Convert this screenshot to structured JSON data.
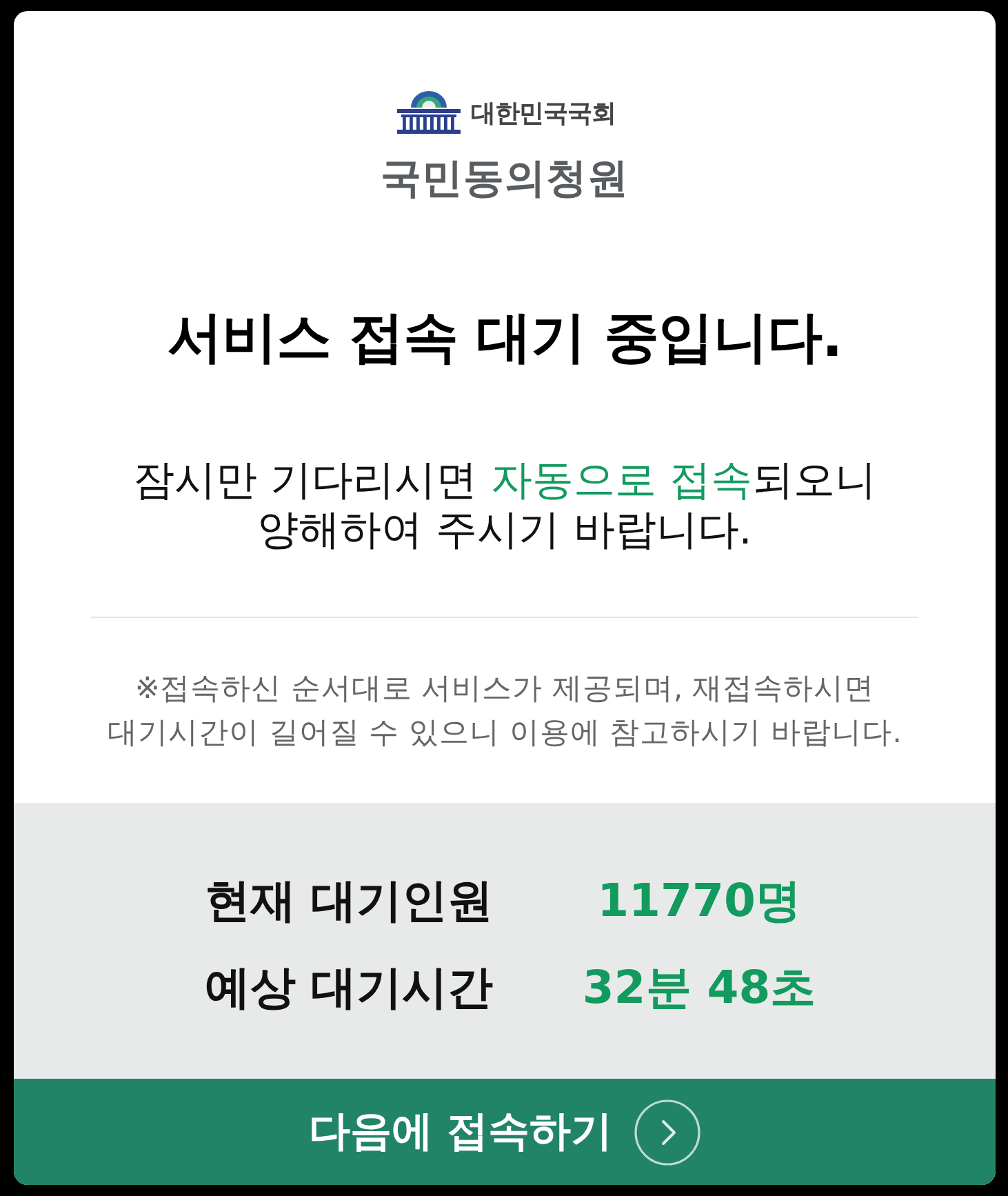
{
  "header": {
    "organization": "대한민국국회",
    "service_name": "국민동의청원"
  },
  "title": "서비스 접속 대기 중입니다.",
  "message": {
    "lines": [
      [
        {
          "text": "잠시만 기다리시면 ",
          "highlight": false
        },
        {
          "text": "자동으로 접속",
          "highlight": true
        },
        {
          "text": "되오니",
          "highlight": false
        }
      ],
      [
        {
          "text": "양해하여 주시기 바랍니다.",
          "highlight": false
        }
      ]
    ]
  },
  "notice": {
    "lines": [
      "※접속하신 순서대로 서비스가 제공되며, 재접속하시면",
      "대기시간이 길어질 수 있으니 이용에 참고하시기 바랍니다."
    ]
  },
  "stats": [
    {
      "label": "현재 대기인원",
      "value": "11770명"
    },
    {
      "label": "예상 대기시간",
      "value": "32분 48초"
    }
  ],
  "button": {
    "label": "다음에 접속하기"
  }
}
